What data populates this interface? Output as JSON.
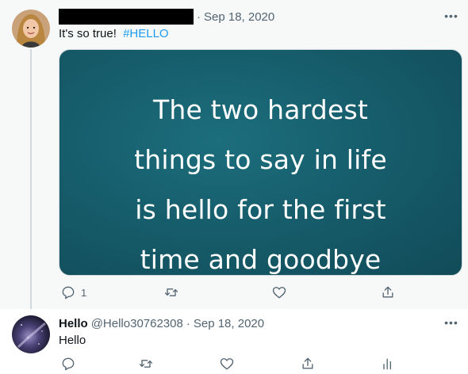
{
  "tweet1": {
    "date": "Sep 18, 2020",
    "separator": "·",
    "text": "It's so true!",
    "hashtag": "#HELLO",
    "more_label": "•••",
    "media": {
      "lines": [
        "The two hardest",
        "things to say in life",
        "is hello for the first",
        "time and goodbye"
      ]
    },
    "actions": {
      "reply_count": "1"
    }
  },
  "tweet2": {
    "name": "Hello",
    "handle": "@Hello30762308",
    "separator": "·",
    "date": "Sep 18, 2020",
    "text": "Hello",
    "more_label": "•••"
  },
  "colors": {
    "accent": "#1d9bf0",
    "muted": "#536471",
    "highlight_bg": "#f7f9f9",
    "media_bg": "#175f6e"
  }
}
